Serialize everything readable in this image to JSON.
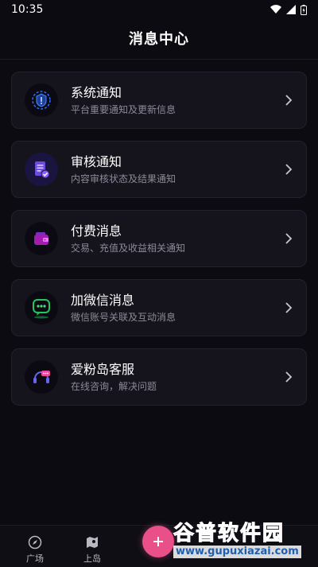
{
  "status_bar": {
    "time": "10:35"
  },
  "header": {
    "title": "消息中心"
  },
  "items": [
    {
      "title": "系统通知",
      "subtitle": "平台重要通知及更新信息",
      "icon": "bell-shield-icon",
      "accent": "#2f6bff"
    },
    {
      "title": "审核通知",
      "subtitle": "内容审核状态及结果通知",
      "icon": "document-check-icon",
      "accent": "#8b5cf6"
    },
    {
      "title": "付费消息",
      "subtitle": "交易、充值及收益相关通知",
      "icon": "wallet-icon",
      "accent": "#c026d3"
    },
    {
      "title": "加微信消息",
      "subtitle": "微信账号关联及互动消息",
      "icon": "wechat-chat-icon",
      "accent": "#22c55e"
    },
    {
      "title": "爱粉岛客服",
      "subtitle": "在线咨询，解决问题",
      "icon": "headset-icon",
      "accent": "#ec4899"
    }
  ],
  "bottom_nav": {
    "items": [
      {
        "label": "广场",
        "icon": "compass-icon"
      },
      {
        "label": "上岛",
        "icon": "map-icon"
      }
    ],
    "fab_icon": "plus-icon"
  },
  "watermark": {
    "text_cn": "谷普软件园",
    "url": "www.gupuxiazai.com"
  }
}
